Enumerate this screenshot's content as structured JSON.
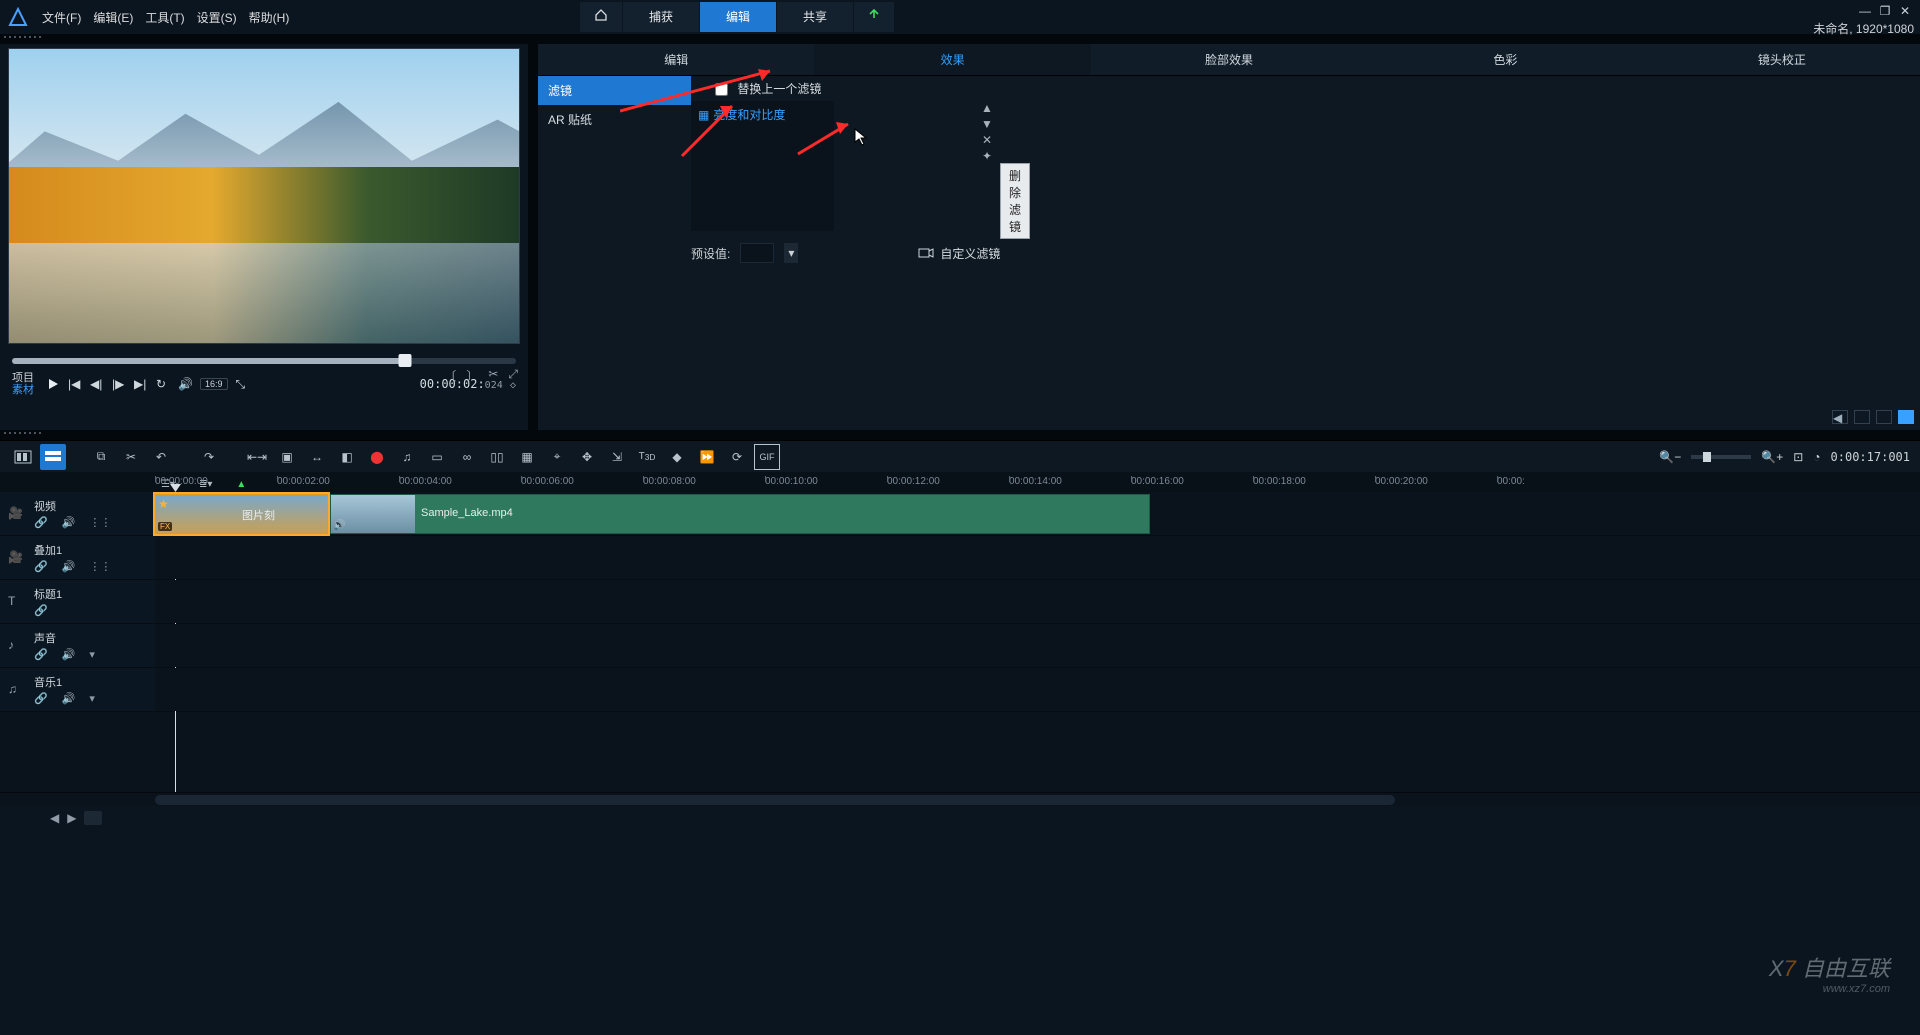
{
  "menu": {
    "file": "文件(F)",
    "edit": "编辑(E)",
    "tools": "工具(T)",
    "settings": "设置(S)",
    "help": "帮助(H)"
  },
  "mainTabs": {
    "capture": "捕获",
    "edit": "编辑",
    "share": "共享"
  },
  "resolution": "未命名, 1920*1080",
  "preview": {
    "proj": "项目",
    "clip": "素材",
    "timecode": "00:00:02:",
    "tcframes": "024",
    "aspect": "16:9"
  },
  "optionTabs": [
    "编辑",
    "效果",
    "脸部效果",
    "色彩",
    "镜头校正"
  ],
  "sideItems": [
    "滤镜",
    "AR 贴纸"
  ],
  "replaceLast": "替换上一个滤镜",
  "filterItem": "亮度和对比度",
  "tooltip": "删除滤镜",
  "preset": "预设值:",
  "customFilter": "自定义滤镜",
  "zoomTime": "0:00:17:001",
  "ruler": [
    "00:00:00:00",
    "00:00:02:00",
    "00:00:04:00",
    "00:00:06:00",
    "00:00:08:00",
    "00:00:10:00",
    "00:00:12:00",
    "00:00:14:00",
    "00:00:16:00",
    "00:00:18:00",
    "00:00:20:00",
    "00:00:"
  ],
  "tracks": [
    {
      "name": "视频",
      "icon": "video",
      "ctrls": [
        "link",
        "vol",
        "grid"
      ]
    },
    {
      "name": "叠加1",
      "icon": "video",
      "ctrls": [
        "link",
        "vol",
        "grid"
      ]
    },
    {
      "name": "标题1",
      "icon": "title",
      "ctrls": [
        "link"
      ]
    },
    {
      "name": "声音",
      "icon": "audio",
      "ctrls": [
        "link",
        "vol",
        "more"
      ]
    },
    {
      "name": "音乐1",
      "icon": "music",
      "ctrls": [
        "link",
        "vol",
        "more"
      ]
    }
  ],
  "clip1": {
    "label": "图片刻",
    "fx": "FX"
  },
  "clip2": {
    "label": "Sample_Lake.mp4"
  },
  "watermark": {
    "brand": "自由互联",
    "url": "www.xz7.com"
  }
}
